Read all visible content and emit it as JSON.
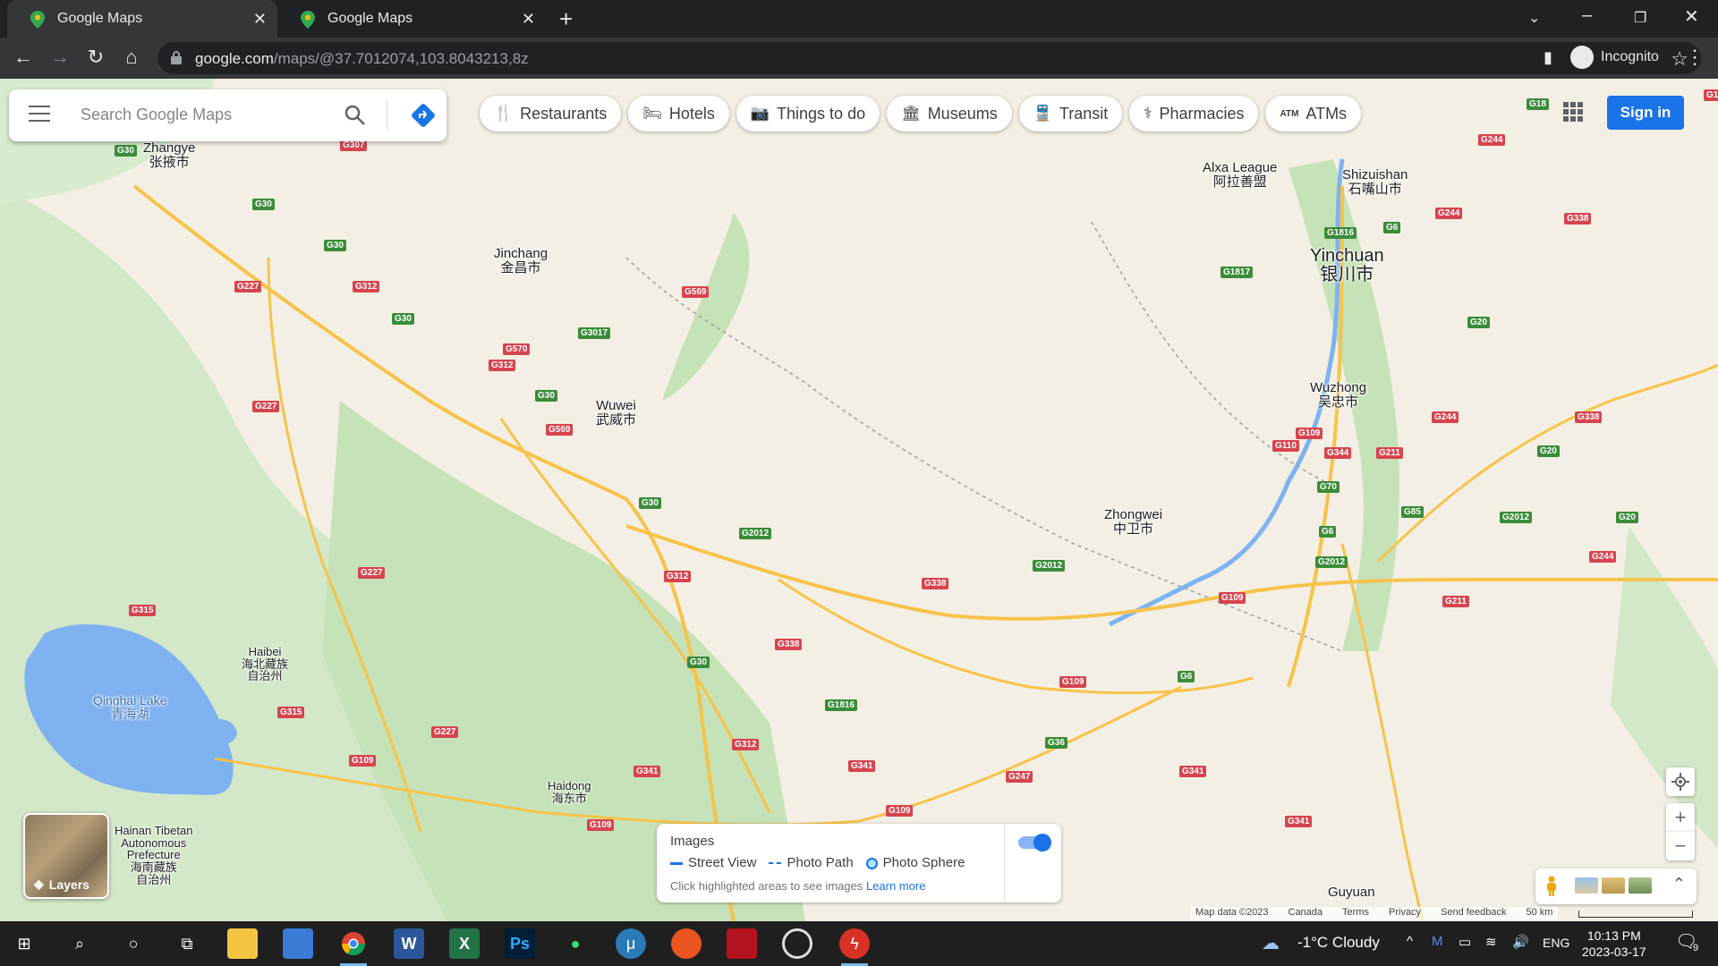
{
  "tabs": [
    {
      "title": "Google Maps",
      "active": true
    },
    {
      "title": "Google Maps",
      "active": false
    }
  ],
  "toolbar": {
    "url_host": "google.com",
    "url_path": "/maps/@37.7012074,103.8043213,8z",
    "profile_label": "Incognito"
  },
  "search": {
    "placeholder": "Search Google Maps"
  },
  "chips": [
    {
      "label": "Restaurants",
      "icon": "fork-knife-icon"
    },
    {
      "label": "Hotels",
      "icon": "bed-icon"
    },
    {
      "label": "Things to do",
      "icon": "camera-icon"
    },
    {
      "label": "Museums",
      "icon": "museum-icon"
    },
    {
      "label": "Transit",
      "icon": "train-icon"
    },
    {
      "label": "Pharmacies",
      "icon": "pharmacy-icon"
    },
    {
      "label": "ATMs",
      "icon": "atm-icon"
    }
  ],
  "header": {
    "sign_in": "Sign in"
  },
  "layers": {
    "label": "Layers"
  },
  "images_panel": {
    "title": "Images",
    "legend": [
      "Street View",
      "Photo Path",
      "Photo Sphere"
    ],
    "hint": "Click highlighted areas to see images",
    "learn_more": "Learn more",
    "toggle_on": true
  },
  "attribution": {
    "map_data": "Map data ©2023",
    "country": "Canada",
    "terms": "Terms",
    "privacy": "Privacy",
    "feedback": "Send feedback",
    "scale": "50 km"
  },
  "map_labels": {
    "zhangye": {
      "en": "Zhangye",
      "zh": "张掖市"
    },
    "jinchang": {
      "en": "Jinchang",
      "zh": "金昌市"
    },
    "wuwei": {
      "en": "Wuwei",
      "zh": "武威市"
    },
    "alxa": {
      "en": "Alxa League",
      "zh": "阿拉善盟"
    },
    "shizuishan": {
      "en": "Shizuishan",
      "zh": "石嘴山市"
    },
    "yinchuan": {
      "en": "Yinchuan",
      "zh": "银川市"
    },
    "wuzhong": {
      "en": "Wuzhong",
      "zh": "吴忠市"
    },
    "zhongwei": {
      "en": "Zhongwei",
      "zh": "中卫市"
    },
    "haibei": {
      "en": "Haibei",
      "zh1": "海北藏族",
      "zh2": "自治州"
    },
    "qinghai_lake": {
      "en": "Qinghai Lake",
      "zh": "青海湖"
    },
    "haidong": {
      "en": "Haidong",
      "zh": "海东市"
    },
    "hainan": {
      "en1": "Hainan Tibetan",
      "en2": "Autonomous",
      "en3": "Prefecture",
      "zh1": "海南藏族",
      "zh2": "自治州"
    },
    "guyuan": {
      "en": "Guyuan"
    }
  },
  "road_shields": [
    {
      "label": "G30",
      "color": "red"
    },
    {
      "label": "G307",
      "color": "red"
    },
    {
      "label": "G227",
      "color": "red"
    },
    {
      "label": "G312",
      "color": "red"
    },
    {
      "label": "G569",
      "color": "red"
    },
    {
      "label": "G570",
      "color": "red"
    },
    {
      "label": "G3017",
      "color": "green"
    },
    {
      "label": "G2012",
      "color": "green"
    },
    {
      "label": "G338",
      "color": "red"
    },
    {
      "label": "G315",
      "color": "red"
    },
    {
      "label": "G109",
      "color": "red"
    },
    {
      "label": "G1816",
      "color": "green"
    },
    {
      "label": "G6",
      "color": "green"
    },
    {
      "label": "G1817",
      "color": "green"
    },
    {
      "label": "G244",
      "color": "red"
    },
    {
      "label": "G18",
      "color": "green"
    },
    {
      "label": "G20",
      "color": "green"
    },
    {
      "label": "G70",
      "color": "green"
    },
    {
      "label": "G110",
      "color": "red"
    },
    {
      "label": "G344",
      "color": "red"
    },
    {
      "label": "G211",
      "color": "red"
    },
    {
      "label": "G85",
      "color": "green"
    },
    {
      "label": "G341",
      "color": "red"
    },
    {
      "label": "G247",
      "color": "red"
    },
    {
      "label": "G36",
      "color": "green"
    },
    {
      "label": "G1",
      "color": "red"
    }
  ],
  "taskbar": {
    "weather": "-1°C  Cloudy",
    "lang": "ENG",
    "time": "10:13 PM",
    "date": "2023-03-17",
    "notifications": "9"
  },
  "colors": {
    "accent": "#1a73e8",
    "map_land": "#f3efe4",
    "map_green": "#cfe8c4",
    "water": "#7fb2f0",
    "highway": "#f6c34a"
  }
}
